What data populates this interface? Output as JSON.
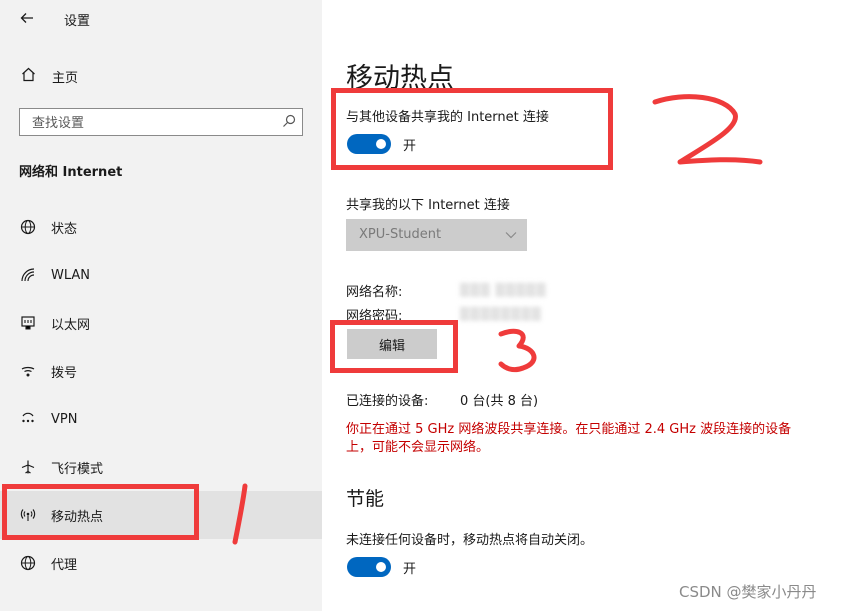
{
  "window": {
    "title": "设置",
    "back_icon": "back-arrow-icon"
  },
  "sidebar": {
    "home_label": "主页",
    "search_placeholder": "查找设置",
    "section_title": "网络和 Internet",
    "items": [
      {
        "label": "状态",
        "icon": "globe-status-icon"
      },
      {
        "label": "WLAN",
        "icon": "wifi-icon"
      },
      {
        "label": "以太网",
        "icon": "ethernet-icon"
      },
      {
        "label": "拨号",
        "icon": "dialup-icon"
      },
      {
        "label": "VPN",
        "icon": "vpn-icon"
      },
      {
        "label": "飞行模式",
        "icon": "airplane-icon"
      },
      {
        "label": "移动热点",
        "icon": "hotspot-icon",
        "active": true
      },
      {
        "label": "代理",
        "icon": "globe-proxy-icon"
      }
    ]
  },
  "main": {
    "title": "移动热点",
    "share_label": "与其他设备共享我的 Internet 连接",
    "share_toggle": {
      "state": "开",
      "on": true
    },
    "share_from_label": "共享我的以下 Internet 连接",
    "share_from_selected": "XPU-Student",
    "network_name_label": "网络名称:",
    "network_password_label": "网络密码:",
    "edit_button": "编辑",
    "connected_label": "已连接的设备:",
    "connected_value": "0 台(共 8 台)",
    "warning": "你正在通过 5 GHz 网络波段共享连接。在只能通过 2.4 GHz 波段连接的设备上，可能不会显示网络。",
    "power_title": "节能",
    "power_desc": "未连接任何设备时，移动热点将自动关闭。",
    "power_toggle": {
      "state": "开",
      "on": true
    }
  },
  "annotations": [
    "1",
    "2",
    "3"
  ],
  "watermark": "CSDN @樊家小丹丹",
  "colors": {
    "accent": "#0067c0",
    "warning": "#c40000",
    "annotation": "#ef3b3b",
    "sidebar_bg": "#f2f2f2"
  }
}
